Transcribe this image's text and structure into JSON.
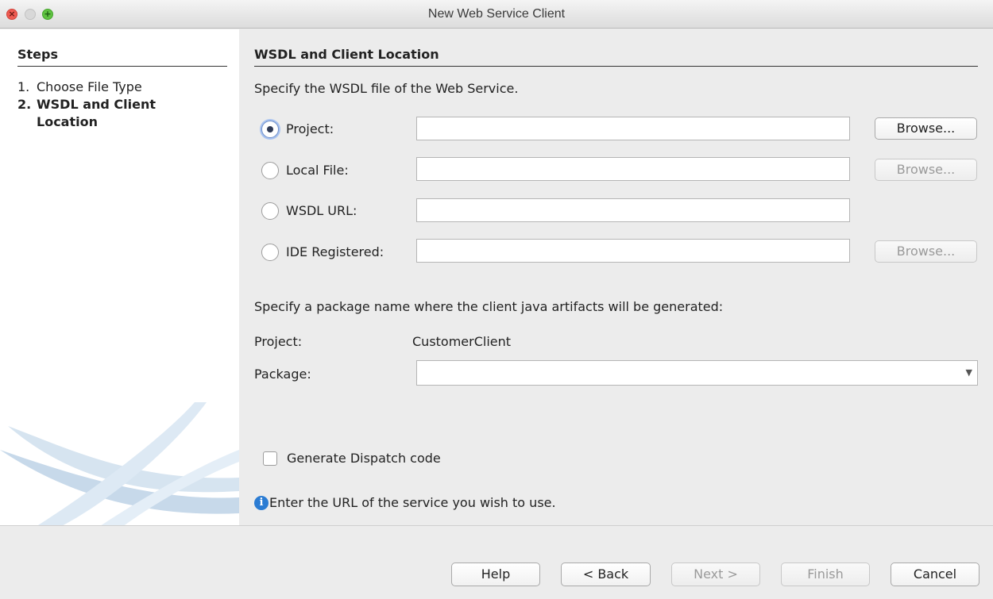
{
  "window": {
    "title": "New Web Service Client"
  },
  "steps": {
    "heading": "Steps",
    "items": [
      {
        "num": "1.",
        "label": "Choose File Type"
      },
      {
        "num": "2.",
        "label": "WSDL and Client Location"
      }
    ]
  },
  "main": {
    "heading": "WSDL and Client Location",
    "instruction": "Specify the WSDL file of the Web Service.",
    "sources": [
      {
        "label": "Project:",
        "value": "",
        "selected": true,
        "browse": "Browse...",
        "browse_enabled": true
      },
      {
        "label": "Local File:",
        "value": "",
        "selected": false,
        "browse": "Browse...",
        "browse_enabled": false
      },
      {
        "label": "WSDL URL:",
        "value": "",
        "selected": false
      },
      {
        "label": "IDE Registered:",
        "value": "",
        "selected": false,
        "browse": "Browse...",
        "browse_enabled": false
      }
    ],
    "package_instruction": "Specify a package name where the client java artifacts will be generated:",
    "project_label": "Project:",
    "project_value": "CustomerClient",
    "package_label": "Package:",
    "package_value": "",
    "dispatch_label": "Generate Dispatch code",
    "dispatch_checked": false,
    "info_message": "Enter the URL of the service you wish to use."
  },
  "buttons": {
    "help": "Help",
    "back": "< Back",
    "next": "Next >",
    "finish": "Finish",
    "cancel": "Cancel"
  },
  "icons": {
    "close": "close-icon",
    "minimize": "minimize-icon",
    "maximize": "maximize-icon",
    "info": "info-icon",
    "dropdown": "chevron-down-icon"
  }
}
